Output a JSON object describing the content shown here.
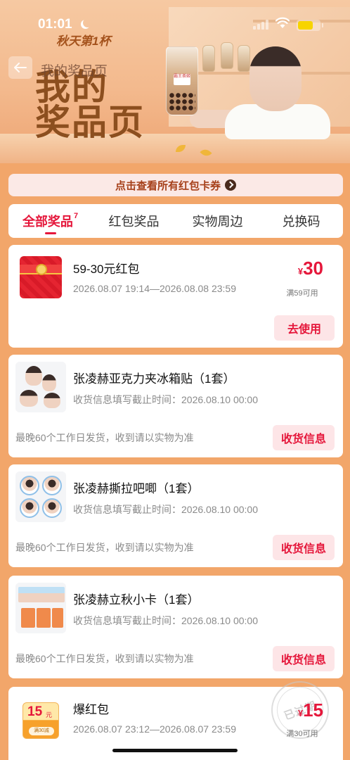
{
  "status_bar": {
    "time": "01:01"
  },
  "hero": {
    "slogan": "秋天第1杯",
    "title_line1": "我的",
    "title_line2": "奖品页",
    "cup_label": "霸王茶姬"
  },
  "nav": {
    "title": "我的奖品页"
  },
  "coupon_link": {
    "label": "点击查看所有红包卡券"
  },
  "tabs": [
    {
      "label": "全部奖品",
      "count": "7",
      "active": true
    },
    {
      "label": "红包奖品"
    },
    {
      "label": "实物周边"
    },
    {
      "label": "兑换码"
    }
  ],
  "prizes": [
    {
      "title": "59-30元红包",
      "subtitle": "2026.08.07 19:14—2026.08.08 23:59",
      "price_symbol": "¥",
      "price": "30",
      "condition": "满59可用",
      "action": "去使用"
    },
    {
      "title": "张凌赫亚克力夹冰箱贴（1套）",
      "subtitle": "收货信息填写截止时间：2026.08.10 00:00",
      "note": "最晚60个工作日发货，收到请以实物为准",
      "action": "收货信息"
    },
    {
      "title": "张凌赫撕拉吧唧（1套）",
      "subtitle": "收货信息填写截止时间：2026.08.10 00:00",
      "note": "最晚60个工作日发货，收到请以实物为准",
      "action": "收货信息"
    },
    {
      "title": "张凌赫立秋小卡（1套）",
      "subtitle": "收货信息填写截止时间：2026.08.10 00:00",
      "note": "最晚60个工作日发货，收到请以实物为准",
      "action": "收货信息"
    },
    {
      "title": "爆红包",
      "subtitle": "2026.08.07 23:12—2026.08.07 23:59",
      "price_symbol": "¥",
      "price": "15",
      "condition": "满30可用",
      "stamp": "已过期",
      "thumb_num": "15",
      "thumb_unit": "元",
      "thumb_cond": "满30减"
    }
  ],
  "colors": {
    "accent": "#e5173b",
    "page_bg": "#f2a66a",
    "button_bg": "#fde5e7"
  }
}
